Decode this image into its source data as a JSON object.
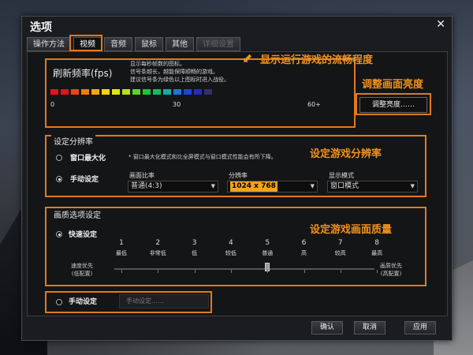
{
  "window": {
    "title": "选项",
    "close_glyph": "✕"
  },
  "tabs": [
    {
      "label": "操作方法",
      "state": "normal"
    },
    {
      "label": "视频",
      "state": "active"
    },
    {
      "label": "音频",
      "state": "normal"
    },
    {
      "label": "鼠标",
      "state": "normal"
    },
    {
      "label": "其他",
      "state": "normal"
    },
    {
      "label": "详细设置",
      "state": "disabled"
    }
  ],
  "annotations": {
    "fps": "显示运行游戏的流畅程度",
    "brightness": "调整画面亮度",
    "resolution": "设定游戏分辨率",
    "quality": "设定游戏画面质量",
    "color": "#e07a1f"
  },
  "fps": {
    "title": "刷新频率(fps)",
    "desc": [
      "显示每秒帧数的图标。",
      "信号条越长，越能保障顺畅的游戏。",
      "建议信号条为绿色以上图标时进入战役。"
    ],
    "ticks": [
      "0",
      "30",
      "60+"
    ],
    "segment_colors": [
      "#e0141a",
      "#e0141a",
      "#e64518",
      "#ee7a10",
      "#f3a812",
      "#f6d414",
      "#e2e414",
      "#b6e018",
      "#5ed12a",
      "#22c23a",
      "#1ab86a",
      "#1aa8a8",
      "#2272d8",
      "#2044d0",
      "#2a2ab8",
      "#303070"
    ]
  },
  "brightness": {
    "button": "调整亮度……"
  },
  "resolution_group": {
    "label": "设定分辨率",
    "maximize": {
      "label": "窗口最大化",
      "note": "* 窗口最大化模式和比全屏模式与窗口模式性能会有所下降。",
      "checked": false
    },
    "manual": {
      "label": "手动设定",
      "checked": true
    },
    "aspect": {
      "label": "画面比率",
      "value": "普通(4:3)"
    },
    "res": {
      "label": "分辨率",
      "value": "1024 x 768"
    },
    "mode": {
      "label": "显示模式",
      "value": "窗口模式"
    }
  },
  "quality_group": {
    "label": "画质选项设定",
    "quick": {
      "label": "快速设定",
      "checked": true
    },
    "levels": [
      {
        "num": "1",
        "label": "最低"
      },
      {
        "num": "2",
        "label": "非常低"
      },
      {
        "num": "3",
        "label": "低"
      },
      {
        "num": "4",
        "label": "较低"
      },
      {
        "num": "5",
        "label": "普通"
      },
      {
        "num": "6",
        "label": "高"
      },
      {
        "num": "7",
        "label": "较高"
      },
      {
        "num": "8",
        "label": "最高"
      }
    ],
    "selected_level": 5,
    "left_side": [
      "速度优先",
      "(低配置)"
    ],
    "right_side": [
      "画质优先",
      "(高配置)"
    ]
  },
  "manual_quality": {
    "label": "手动设定",
    "checked": false,
    "button": "手动设定……"
  },
  "footer": {
    "ok": "确认",
    "cancel": "取消",
    "apply": "应用"
  }
}
